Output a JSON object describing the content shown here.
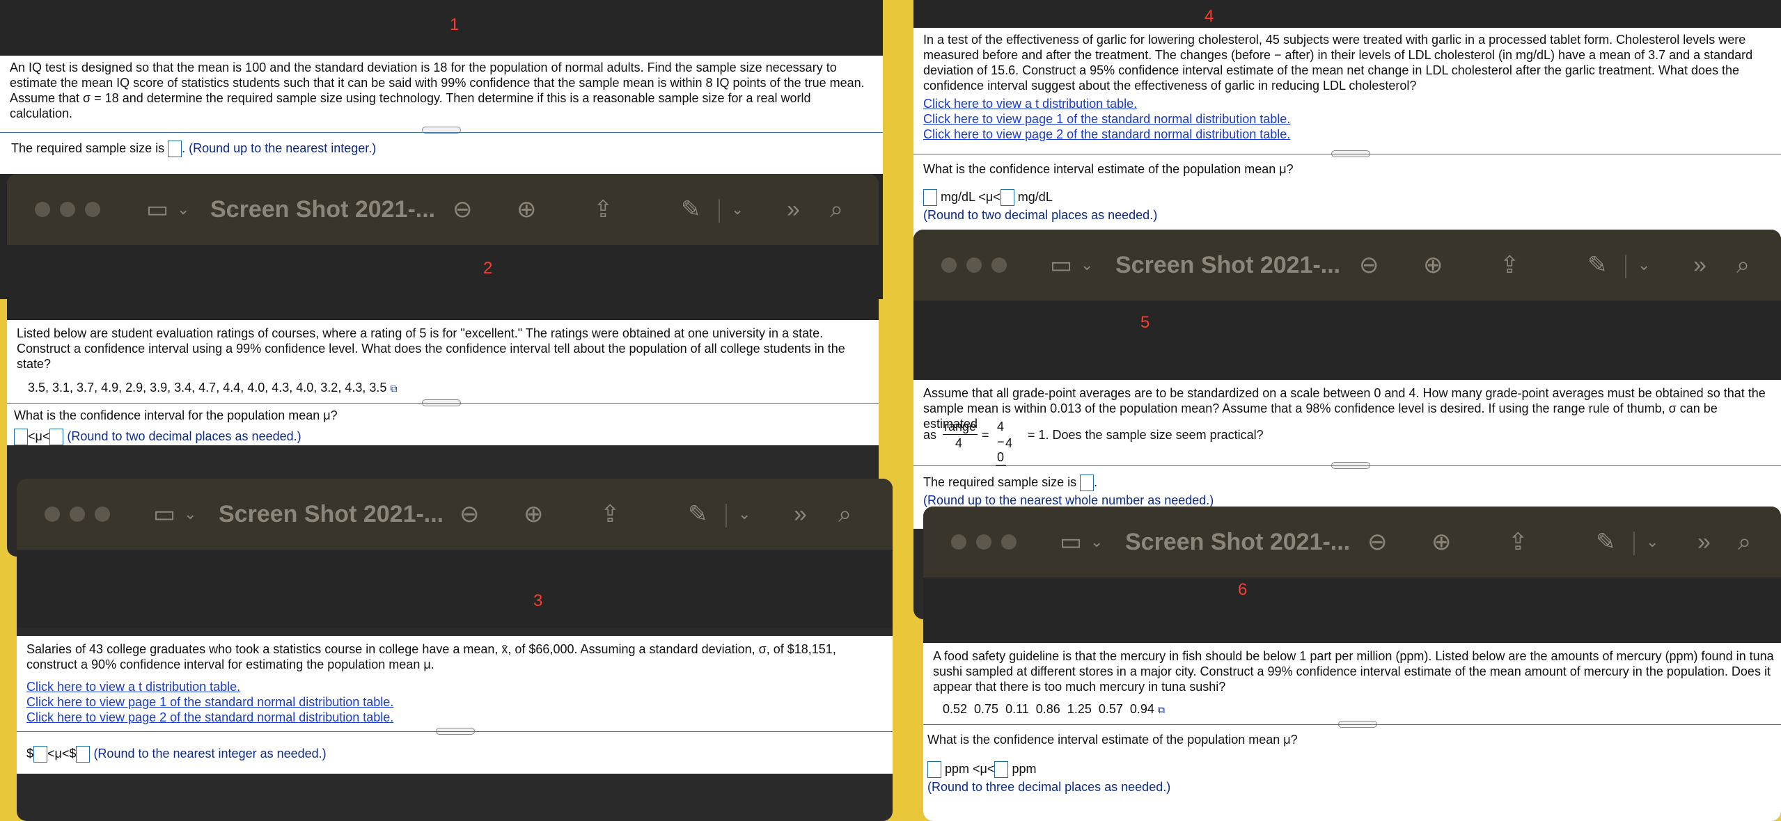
{
  "toolbar": {
    "title": "Screen Shot 2021-...",
    "sidebar_icon": "▭",
    "chevron": "⌄",
    "zoom_out": "⊖",
    "zoom_in": "⊕",
    "share": "⇪",
    "pen": "✎",
    "more": "»",
    "search": "⌕"
  },
  "panels": {
    "p1": {
      "number": "1",
      "question": "An IQ test is designed so that the mean is 100 and the standard deviation is 18 for the population of normal adults. Find the sample size necessary to estimate the mean IQ score of statistics students such that it can be said with 99% confidence that the sample mean is within 8 IQ points of the true mean. Assume that σ = 18 and determine the required sample size using technology. Then determine if this is a reasonable sample size for a real world calculation.",
      "answer_prefix": "The required sample size is",
      "answer_suffix": ". (Round up to the nearest integer.)"
    },
    "p2": {
      "number": "2",
      "question": "Listed below are student evaluation ratings of courses, where a rating of 5 is for \"excellent.\" The ratings were obtained at one university in a state. Construct a confidence interval using a 99% confidence level. What does the confidence interval tell about the population of all college students in the state?",
      "data": "3.5, 3.1, 3.7, 4.9, 2.9, 3.9, 3.4, 4.7, 4.4, 4.0, 4.3, 4.0, 3.2, 4.3, 3.5",
      "prompt": "What is the confidence interval for the population mean μ?",
      "mid": "<μ<",
      "hint": "(Round to two decimal places as needed.)"
    },
    "p3": {
      "number": "3",
      "question": "Salaries of 43 college graduates who took a statistics course in college have a mean, x̄, of $66,000. Assuming a standard deviation, σ, of $18,151, construct a 90% confidence interval for estimating the population mean μ.",
      "links": [
        "Click here to view a t distribution table.",
        "Click here to view page 1 of the standard normal distribution table.",
        "Click here to view page 2 of the standard normal distribution table."
      ],
      "dollar": "$",
      "mid": "<μ<$",
      "hint": "(Round to the nearest integer as needed.)"
    },
    "p4": {
      "number": "4",
      "question": "In a test of the effectiveness of garlic for lowering cholesterol, 45 subjects were treated with garlic in a processed tablet form. Cholesterol levels were measured before and after the treatment. The changes (before − after) in their levels of LDL cholesterol (in mg/dL) have a mean of 3.7 and a standard deviation of 15.6. Construct a 95% confidence interval estimate of the mean net change in LDL cholesterol after the garlic treatment. What does the confidence interval suggest about the effectiveness of garlic in reducing LDL cholesterol?",
      "links": [
        "Click here to view a t distribution table.",
        "Click here to view page 1 of the standard normal distribution table.",
        "Click here to view page 2 of the standard normal distribution table."
      ],
      "prompt": "What is the confidence interval estimate of the population mean μ?",
      "mid": "mg/dL <μ<",
      "unit": "mg/dL",
      "hint": "(Round to two decimal places as needed.)"
    },
    "p5": {
      "number": "5",
      "question": "Assume that all grade-point averages are to be standardized on a scale between 0 and 4. How many grade-point averages must be obtained so that the sample mean is within 0.013 of the population mean? Assume that a 98% confidence level is desired. If using the range rule of thumb, σ can be estimated",
      "as": "as",
      "frac1_num": "range",
      "frac1_den": "4",
      "eq": "=",
      "frac2_num": "4 − 0",
      "frac2_den": "4",
      "tail": "= 1. Does the sample size seem practical?",
      "answer_prefix": "The required sample size is",
      "answer_suffix": ".",
      "hint": "(Round up to the nearest whole number as needed.)"
    },
    "p6": {
      "number": "6",
      "question": "A food safety guideline is that the mercury in fish should be below 1 part per million (ppm). Listed below are the amounts of mercury (ppm) found in tuna sushi sampled at different stores in a major city. Construct a 99% confidence interval estimate of the mean amount of mercury in the population. Does it appear that there is too much mercury in tuna sushi?",
      "data": "0.52  0.75  0.11  0.86  1.25  0.57  0.94",
      "prompt": "What is the confidence interval estimate of the population mean μ?",
      "mid": "ppm <μ<",
      "unit": "ppm",
      "hint": "(Round to three decimal places as needed.)"
    }
  }
}
